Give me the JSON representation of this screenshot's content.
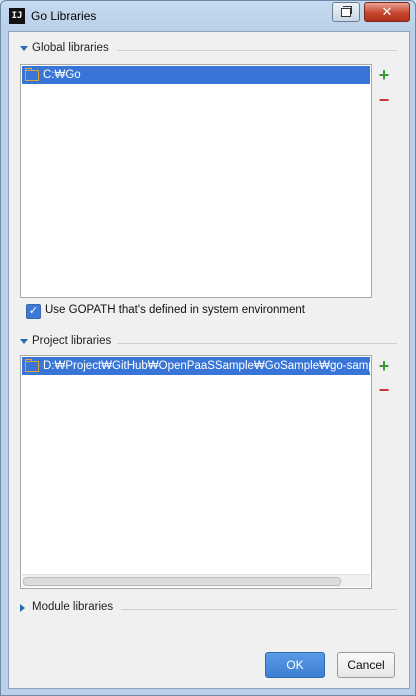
{
  "window": {
    "app_icon": "IJ",
    "title": "Go Libraries",
    "restore_icon": "restore-icon",
    "close_glyph": "✕"
  },
  "global_libraries": {
    "header": "Global libraries",
    "items": [
      {
        "label": "C:₩Go",
        "icon": "folder-icon"
      }
    ],
    "add_glyph": "+",
    "remove_glyph": "−"
  },
  "gopath_option": {
    "checked": true,
    "check_glyph": "✓",
    "label": "Use GOPATH that's defined in system environment"
  },
  "project_libraries": {
    "header": "Project libraries",
    "items": [
      {
        "label": "D:₩Project₩GitHub₩OpenPaaSSample₩GoSample₩go-samp",
        "icon": "folder-icon"
      }
    ],
    "add_glyph": "+",
    "remove_glyph": "−"
  },
  "module_libraries": {
    "header": "Module libraries"
  },
  "buttons": {
    "ok": "OK",
    "cancel": "Cancel"
  },
  "colors": {
    "selection": "#3875d7",
    "add": "#3a9a3a",
    "remove": "#cc3333",
    "accent": "#2d6ab4"
  }
}
